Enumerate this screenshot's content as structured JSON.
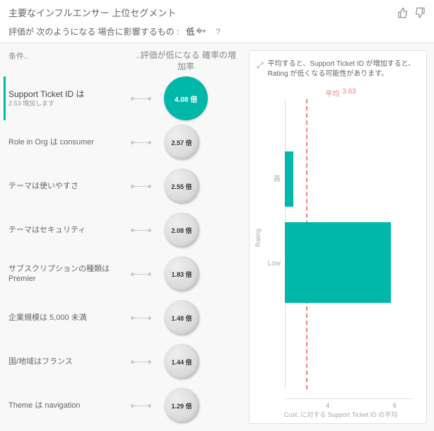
{
  "header": {
    "title": "主要なインフルエンサー 上位セグメント",
    "subtitle_prefix": "評価が 次のようになる 場合に影響するもの :",
    "dropdown_value": "低",
    "help": "?"
  },
  "left": {
    "col_condition": "条件..",
    "col_prob": "..評価が低になる\n確率の増加率",
    "influencers": [
      {
        "label": "Support Ticket ID は",
        "sub": "2.53 増加します",
        "value": "4.08 倍",
        "selected": true
      },
      {
        "label": "Role in Org は consumer",
        "value": "2.57 倍"
      },
      {
        "label": "テーマは使いやすさ",
        "value": "2.55 倍"
      },
      {
        "label": "テーマはセキュリティ",
        "value": "2.08 倍"
      },
      {
        "label": "サブスクリプションの種類は Premier",
        "value": "1.83 倍"
      },
      {
        "label": "企業規模は 5,000 未満",
        "value": "1.48 倍"
      },
      {
        "label": "国/地域はフランス",
        "value": "1.44 倍"
      },
      {
        "label": "Theme は navigation",
        "value": "1.29 倍"
      }
    ]
  },
  "right": {
    "desc": "平均すると、Support Ticket ID が増加すると、Rating が低くなる可能性があります。",
    "avg_label": "平均",
    "avg_value": "3.63",
    "y_title": "Rating",
    "y_high": "高",
    "y_low": "Low",
    "x_title": "Cust. に対する Support Ticket ID の平均",
    "x_ticks": [
      "4",
      "6"
    ]
  },
  "chart_data": {
    "type": "bar",
    "orientation": "horizontal",
    "title": "平均すると、Support Ticket ID が増加すると、Rating が低くなる可能性があります。",
    "ylabel": "Rating",
    "xlabel": "Cust. に対する Support Ticket ID の平均",
    "categories": [
      "高",
      "Low"
    ],
    "values": [
      3.3,
      5.8
    ],
    "reference_line": {
      "label": "平均",
      "value": 3.63
    },
    "xlim": [
      3,
      7
    ]
  }
}
